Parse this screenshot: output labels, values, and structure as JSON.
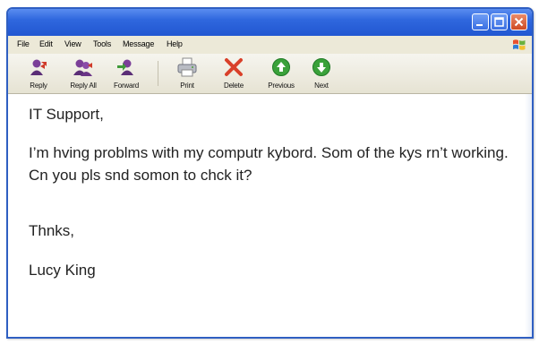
{
  "window": {
    "colors": {
      "titlebar": "#2f67de",
      "close": "#cf4a23",
      "chrome": "#ece9d8"
    }
  },
  "menu": {
    "items": [
      {
        "label": "File"
      },
      {
        "label": "Edit"
      },
      {
        "label": "View"
      },
      {
        "label": "Tools"
      },
      {
        "label": "Message"
      },
      {
        "label": "Help"
      }
    ]
  },
  "toolbar": {
    "buttons": [
      {
        "label": "Reply",
        "icon": "reply-icon"
      },
      {
        "label": "Reply All",
        "icon": "reply-all-icon"
      },
      {
        "label": "Forward",
        "icon": "forward-icon"
      },
      {
        "label": "Print",
        "icon": "printer-icon"
      },
      {
        "label": "Delete",
        "icon": "delete-x-icon"
      },
      {
        "label": "Previous",
        "icon": "up-arrow-icon"
      },
      {
        "label": "Next",
        "icon": "down-arrow-icon"
      }
    ]
  },
  "message": {
    "greeting": "IT Support,",
    "body": "I’m hving problms with my computr kybord. Som of the kys rn’t working. Cn you pls snd somon to chck it?",
    "closing": "Thnks,",
    "signature": "Lucy King"
  }
}
